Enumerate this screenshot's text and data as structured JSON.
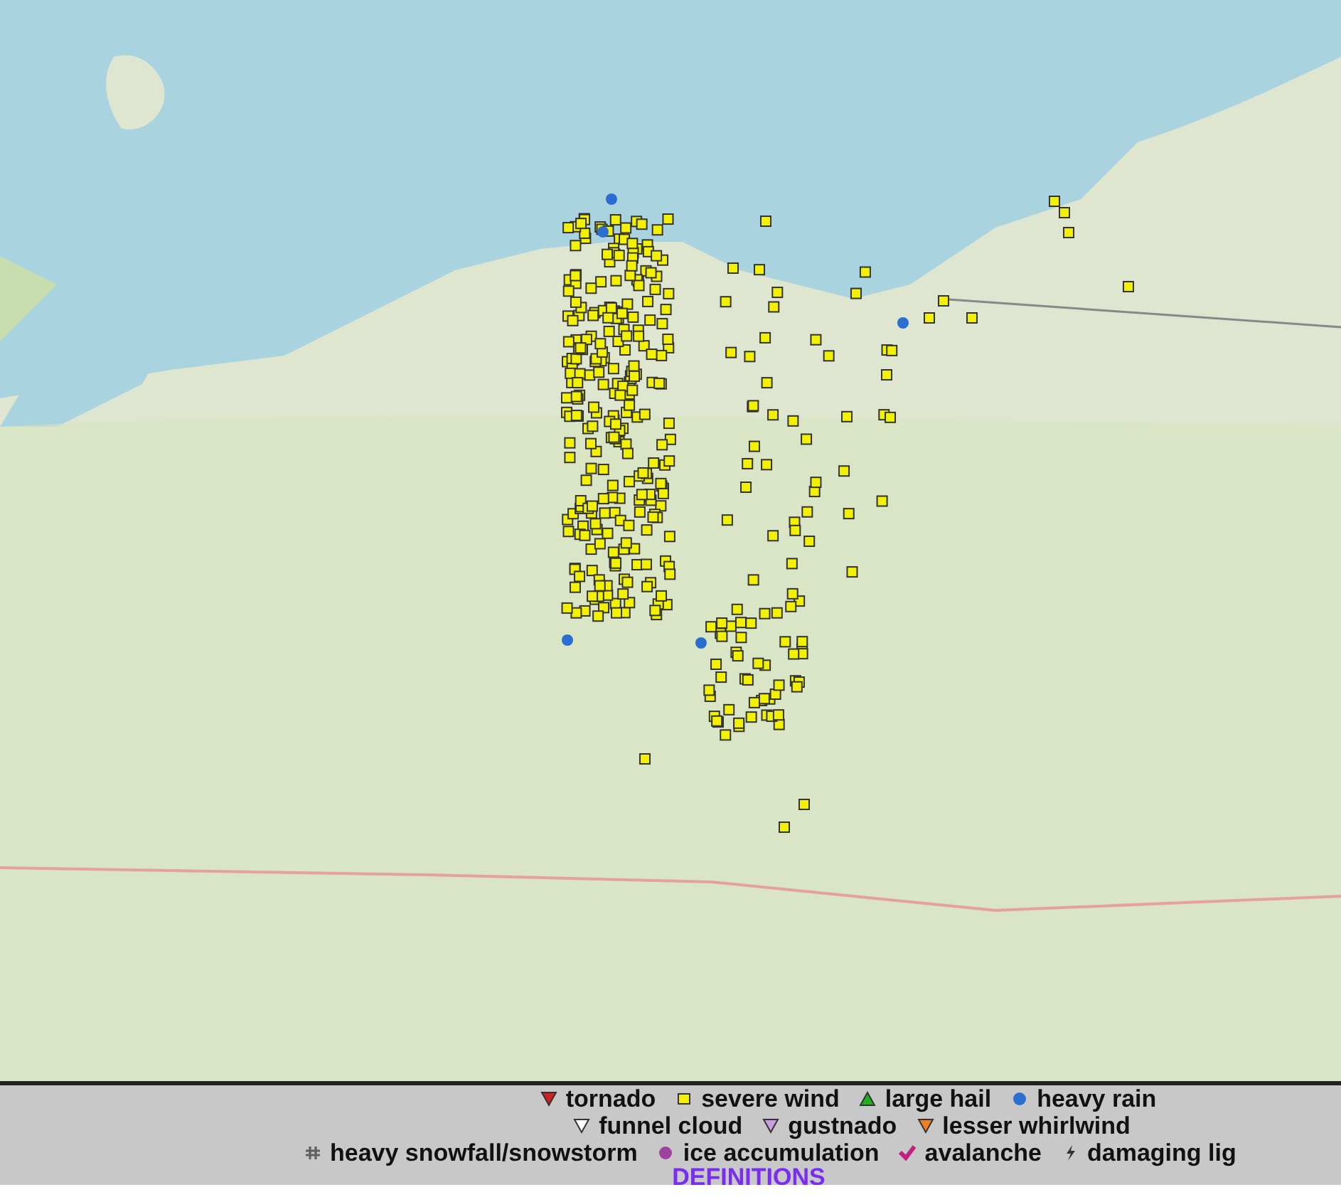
{
  "legend": {
    "rows": [
      [
        {
          "kind": "triangle-down",
          "color": "#d42020",
          "label": "tornado"
        },
        {
          "kind": "square",
          "color": "#f2f200",
          "label": "severe wind"
        },
        {
          "kind": "triangle-up",
          "color": "#20b020",
          "label": "large hail"
        },
        {
          "kind": "circle",
          "color": "#2a6fd0",
          "label": "heavy rain"
        }
      ],
      [
        {
          "kind": "triangle-down",
          "color": "#ffffff",
          "label": "funnel cloud"
        },
        {
          "kind": "triangle-down",
          "color": "#c8a0e0",
          "label": "gustnado"
        },
        {
          "kind": "triangle-down",
          "color": "#f08020",
          "label": "lesser whirlwind"
        }
      ],
      [
        {
          "kind": "hash",
          "color": "#606060",
          "label": "heavy snowfall/snowstorm"
        },
        {
          "kind": "circle",
          "color": "#a040a0",
          "label": "ice accumulation"
        },
        {
          "kind": "check",
          "color": "#c02080",
          "label": "avalanche"
        },
        {
          "kind": "bolt",
          "color": "#303030",
          "label": "damaging lig"
        }
      ]
    ],
    "link": "DEFINITIONS"
  }
}
